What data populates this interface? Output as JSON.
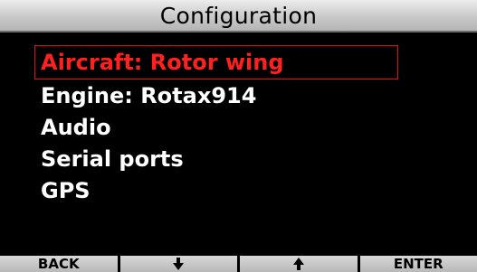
{
  "header": {
    "title": "Configuration"
  },
  "menu": {
    "selected_index": 0,
    "items": [
      {
        "label": "Aircraft: Rotor wing"
      },
      {
        "label": "Engine: Rotax914"
      },
      {
        "label": "Audio"
      },
      {
        "label": "Serial ports"
      },
      {
        "label": "GPS"
      }
    ]
  },
  "softkeys": [
    {
      "label": "BACK",
      "icon": null
    },
    {
      "label": "",
      "icon": "arrow-down-icon"
    },
    {
      "label": "",
      "icon": "arrow-up-icon"
    },
    {
      "label": "ENTER",
      "icon": null
    }
  ],
  "colors": {
    "selected_text": "#ff2020",
    "selection_border": "#e01010",
    "normal_text": "#ffffff",
    "background": "#000000"
  }
}
